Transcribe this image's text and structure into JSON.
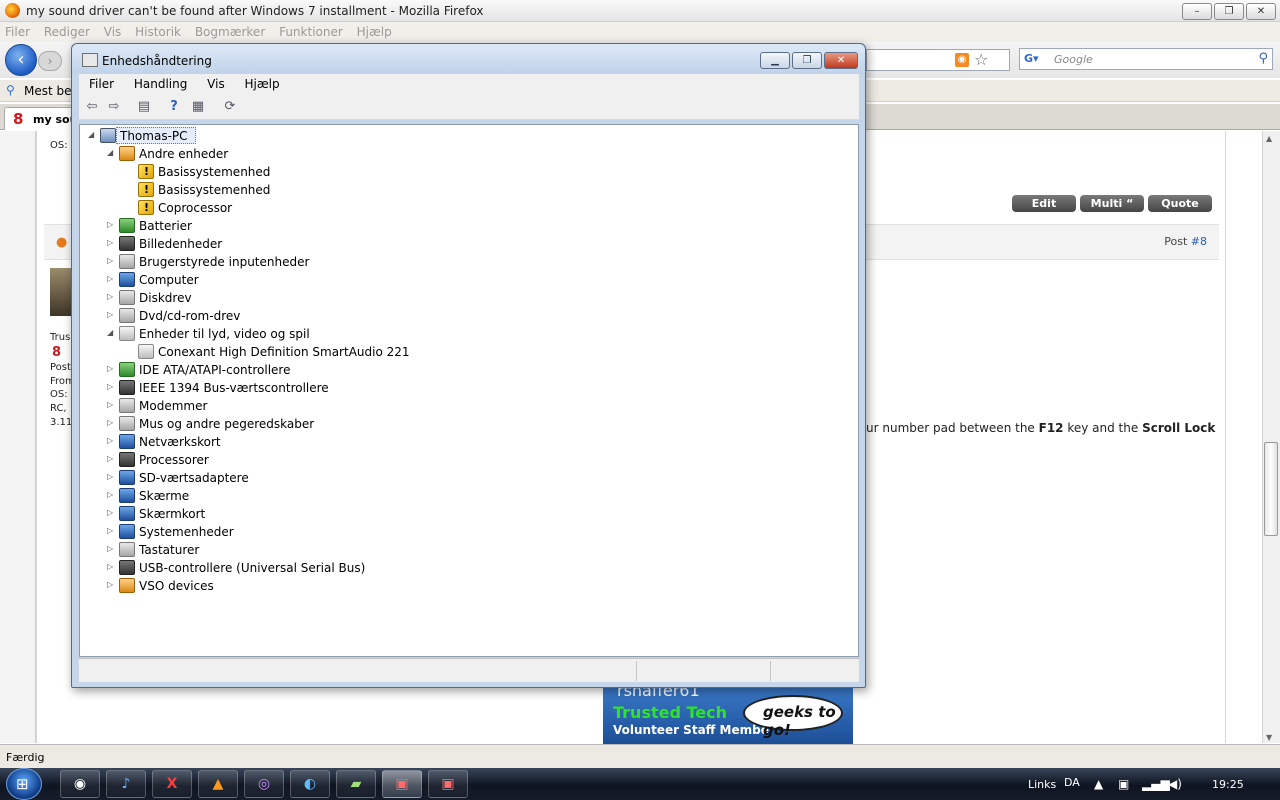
{
  "browser": {
    "title": "my sound driver can't be found after Windows 7 installment - Mozilla Firefox",
    "menu": [
      "Filer",
      "Rediger",
      "Vis",
      "Historik",
      "Bogmærker",
      "Funktioner",
      "Hjælp"
    ],
    "search_placeholder": "Google",
    "bookmarks_label": "Mest bes",
    "tab_label": "my sound",
    "status": "Færdig"
  },
  "page": {
    "buttons": {
      "edit": "Edit",
      "multi": "Multi “",
      "quote": "Quote"
    },
    "post_label": "Post ",
    "post_number": "#8",
    "side": {
      "os_top": "OS:",
      "trusted": "Trus",
      "post": "Post",
      "from": "From",
      "os": "OS:",
      "rc": "RC,",
      "ver": "3.11"
    },
    "post_text_before": "ur number pad between the ",
    "post_key1": "F12",
    "post_text_mid": " key and the ",
    "post_key2": "Scroll Lock",
    "signature": {
      "name": "rshaffer61",
      "trusted": "Trusted Tech",
      "staff": "Volunteer Staff Member",
      "logo": "geeks to go!"
    }
  },
  "device_manager": {
    "title": "Enhedshåndtering",
    "menu": [
      "Filer",
      "Handling",
      "Vis",
      "Hjælp"
    ],
    "root": "Thomas-PC",
    "tree": [
      {
        "label": "Andre enheder",
        "expanded": true,
        "children": [
          "Basissystemenhed",
          "Basissystemenhed",
          "Coprocessor"
        ]
      },
      {
        "label": "Batterier"
      },
      {
        "label": "Billedenheder"
      },
      {
        "label": "Brugerstyrede inputenheder"
      },
      {
        "label": "Computer"
      },
      {
        "label": "Diskdrev"
      },
      {
        "label": "Dvd/cd-rom-drev"
      },
      {
        "label": "Enheder til lyd, video og spil",
        "expanded": true,
        "children": [
          "Conexant High Definition SmartAudio 221"
        ]
      },
      {
        "label": "IDE ATA/ATAPI-controllere"
      },
      {
        "label": "IEEE 1394 Bus-værtscontrollere"
      },
      {
        "label": "Modemmer"
      },
      {
        "label": "Mus og andre pegeredskaber"
      },
      {
        "label": "Netværkskort"
      },
      {
        "label": "Processorer"
      },
      {
        "label": "SD-værtsadaptere"
      },
      {
        "label": "Skærme"
      },
      {
        "label": "Skærmkort"
      },
      {
        "label": "Systemenheder"
      },
      {
        "label": "Tastaturer"
      },
      {
        "label": "USB-controllere (Universal Serial Bus)"
      },
      {
        "label": "VSO devices"
      }
    ]
  },
  "taskbar": {
    "links": "Links",
    "lang": "DA",
    "clock": "19:25"
  }
}
